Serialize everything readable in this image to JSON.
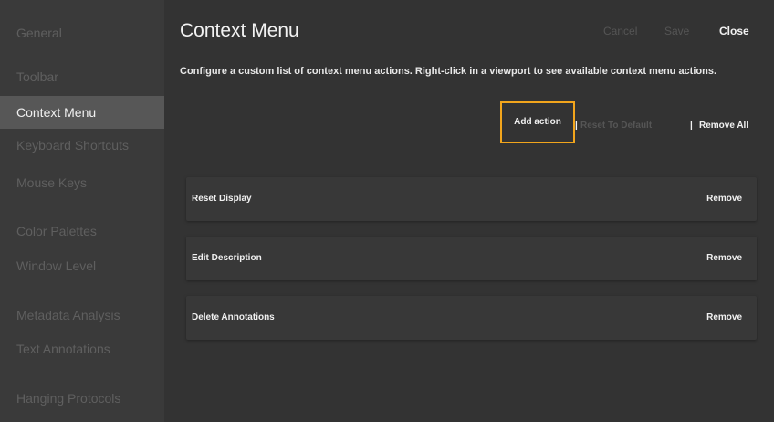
{
  "sidebar": {
    "items": [
      {
        "label": "General"
      },
      {
        "label": "Toolbar"
      },
      {
        "label": "Context Menu"
      },
      {
        "label": "Keyboard Shortcuts"
      },
      {
        "label": "Mouse Keys"
      },
      {
        "label": "Color Palettes"
      },
      {
        "label": "Window Level"
      },
      {
        "label": "Metadata Analysis"
      },
      {
        "label": "Text Annotations"
      },
      {
        "label": "Hanging Protocols"
      }
    ],
    "active_index": 2
  },
  "header": {
    "title": "Context Menu",
    "cancel_label": "Cancel",
    "save_label": "Save",
    "close_label": "Close"
  },
  "main": {
    "description": "Configure a custom list of context menu actions. Right-click in a viewport to see available context menu actions.",
    "add_action_label": "Add action",
    "separator": "|",
    "reset_label": "Reset To Default",
    "remove_all_label": "Remove All",
    "actions": [
      {
        "label": "Reset Display",
        "remove_label": "Remove"
      },
      {
        "label": "Edit Description",
        "remove_label": "Remove"
      },
      {
        "label": "Delete Annotations",
        "remove_label": "Remove"
      }
    ]
  },
  "colors": {
    "highlight": "#f2a51c",
    "active_sidebar_bg": "#575757"
  }
}
